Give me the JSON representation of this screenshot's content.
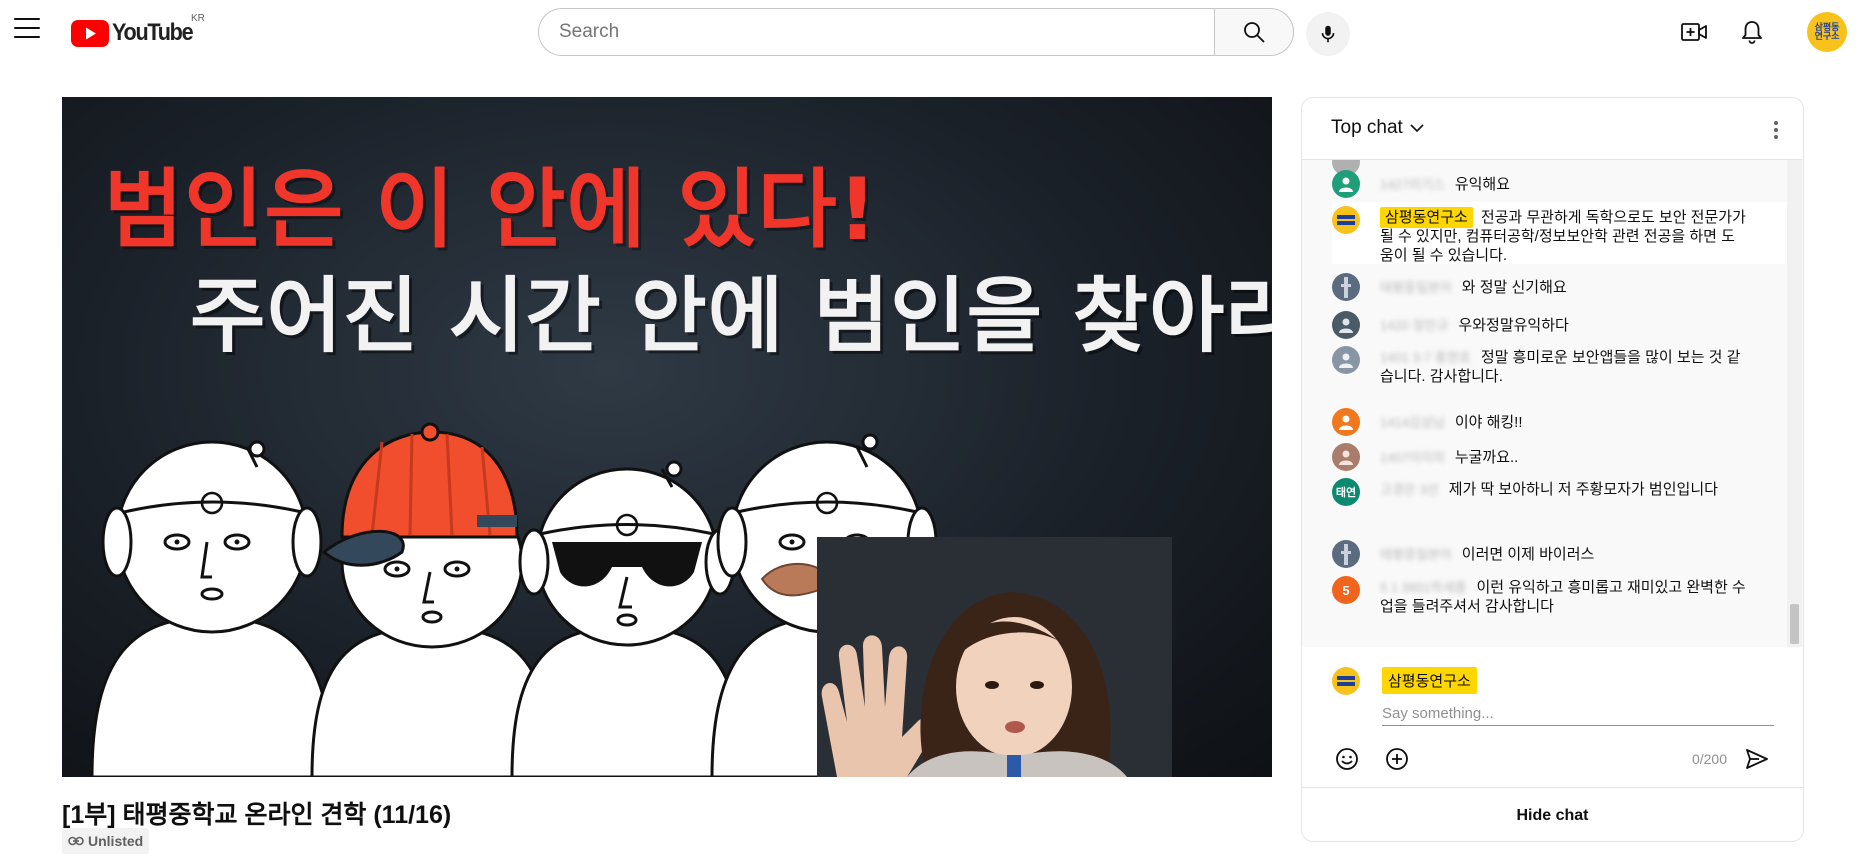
{
  "header": {
    "logo_text": "YouTube",
    "country_code": "KR",
    "search_placeholder": "Search",
    "avatar_text_line1": "삼평동",
    "avatar_text_line2": "연구소"
  },
  "video": {
    "overlay_line1": "범인은 이 안에 있다!",
    "overlay_line2": "주어진 시간 안에 범인을 찾아라!",
    "title": "[1부] 태평중학교 온라인 견학 (11/16)",
    "visibility_label": "Unlisted"
  },
  "chat": {
    "title": "Top chat",
    "messages": [
      {
        "author": "1427리기스",
        "text": "유익해요",
        "avatar_color": "#1e9e79",
        "avatar_text": ""
      },
      {
        "author": "삼평동연구소",
        "text": "전공과 무관하게 독학으로도 보안 전문가가 될 수 있지만, 컴퓨터공학/정보보안학 관련 전공을 하면 도움이 될 수 있습니다.",
        "avatar_color": "#f7c21b",
        "avatar_text": "",
        "owner": true
      },
      {
        "author": "태평중일본어",
        "text": "와 정말 신기해요",
        "avatar_color": "#5b6b80",
        "avatar_text": ""
      },
      {
        "author": "1420 정민규",
        "text": "우와정말유익하다",
        "avatar_color": "#4a5a66",
        "avatar_text": ""
      },
      {
        "author": "1401 3-7 홍현호",
        "text": "정말 흥미로운 보안앱들을 많이 보는 것 같습니다. 감사합니다.",
        "avatar_color": "#8795a5",
        "avatar_text": ""
      },
      {
        "author": "1414김성님",
        "text": "이야 해킹!!",
        "avatar_color": "#f0781e",
        "avatar_text": ""
      },
      {
        "author": "1407이이의",
        "text": "누굴까요..",
        "avatar_color": "#a97c6b",
        "avatar_text": ""
      },
      {
        "author": "고경은 3선",
        "text": "제가 딱 보아하니 저 주황모자가 범인입니다",
        "avatar_color": "#0b8a6f",
        "avatar_text": "태연"
      },
      {
        "author": "태평중일본어",
        "text": "이러면 이제 바이러스",
        "avatar_color": "#5b6b80",
        "avatar_text": ""
      },
      {
        "author": "5 1 3801하세흥",
        "text": "이런 유익하고 흥미롭고 재미있고 완벽한 수업을 들려주셔서 감사합니다",
        "avatar_color": "#f0641e",
        "avatar_text": "5"
      }
    ],
    "input": {
      "author": "삼평동연구소",
      "placeholder": "Say something...",
      "counter": "0/200"
    },
    "hide_label": "Hide chat"
  }
}
